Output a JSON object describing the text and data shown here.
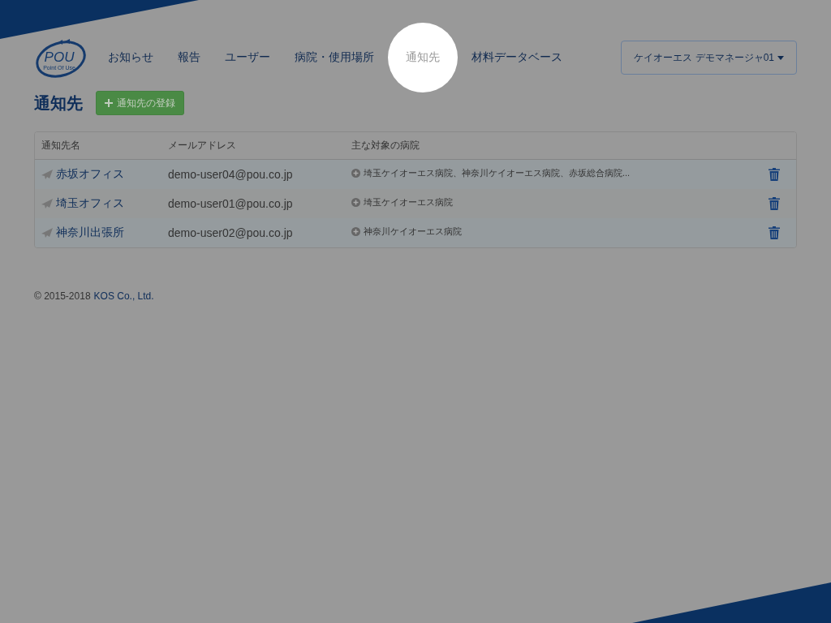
{
  "logo": {
    "text": "POU",
    "subtitle": "Point Of Use"
  },
  "nav": [
    {
      "label": "お知らせ",
      "selected": false
    },
    {
      "label": "報告",
      "selected": false
    },
    {
      "label": "ユーザー",
      "selected": false
    },
    {
      "label": "病院・使用場所",
      "selected": false
    },
    {
      "label": "通知先",
      "selected": true
    },
    {
      "label": "材料データベース",
      "selected": false
    }
  ],
  "user_menu": {
    "label": "ケイオーエス デモマネージャ01"
  },
  "page_title": "通知先",
  "add_button": {
    "label": "通知先の登録"
  },
  "table": {
    "columns": [
      "通知先名",
      "メールアドレス",
      "主な対象の病院"
    ],
    "rows": [
      {
        "name": "赤坂オフィス",
        "email": "demo-user04@pou.co.jp",
        "hospitals": "埼玉ケイオーエス病院、神奈川ケイオーエス病院、赤坂総合病院..."
      },
      {
        "name": "埼玉オフィス",
        "email": "demo-user01@pou.co.jp",
        "hospitals": "埼玉ケイオーエス病院"
      },
      {
        "name": "神奈川出張所",
        "email": "demo-user02@pou.co.jp",
        "hospitals": "神奈川ケイオーエス病院"
      }
    ]
  },
  "footer": {
    "copyright": "© 2015-2018",
    "company": "KOS Co., Ltd."
  }
}
